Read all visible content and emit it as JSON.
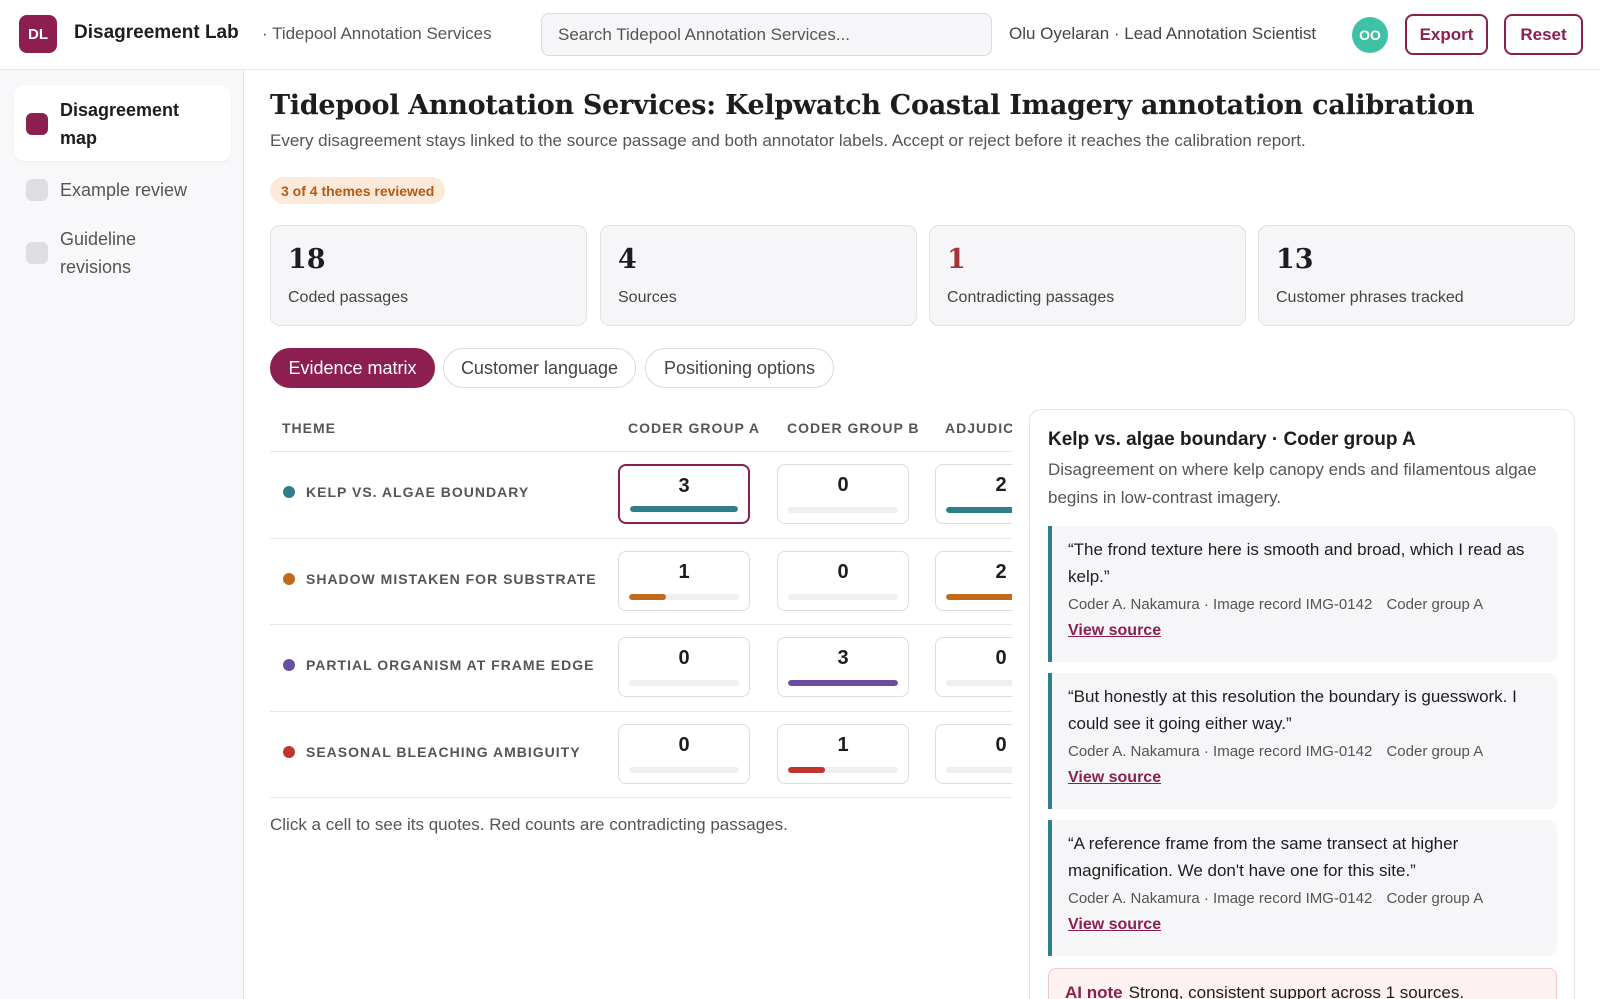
{
  "header": {
    "logo_initials": "DL",
    "app_name": "Disagreement Lab",
    "org_name": "· Tidepool Annotation Services",
    "search_placeholder": "Search Tidepool Annotation Services...",
    "user": "Olu Oyelaran · Lead Annotation Scientist",
    "avatar_initials": "OO",
    "export_label": "Export",
    "reset_label": "Reset"
  },
  "sidebar": {
    "items": [
      {
        "label": "Disagreement map",
        "active": true
      },
      {
        "label": "Example review",
        "active": false
      },
      {
        "label": "Guideline revisions",
        "active": false
      }
    ]
  },
  "main": {
    "title": "Tidepool Annotation Services: Kelpwatch Coastal Imagery annotation calibration",
    "subtitle": "Every disagreement stays linked to the source passage and both annotator labels. Accept or reject before it reaches the calibration report.",
    "progress_badge": "3 of 4 themes reviewed",
    "stats": [
      {
        "value": "18",
        "label": "Coded passages",
        "highlight": false
      },
      {
        "value": "4",
        "label": "Sources",
        "highlight": false
      },
      {
        "value": "1",
        "label": "Contradicting passages",
        "highlight": true
      },
      {
        "value": "13",
        "label": "Customer phrases tracked",
        "highlight": false
      }
    ],
    "tabs": [
      {
        "label": "Evidence matrix",
        "active": true
      },
      {
        "label": "Customer language",
        "active": false
      },
      {
        "label": "Positioning options",
        "active": false
      }
    ]
  },
  "matrix": {
    "columns": [
      "THEME",
      "CODER GROUP A",
      "CODER GROUP B",
      "ADJUDICATED"
    ],
    "max_count": 3,
    "rows": [
      {
        "theme": "KELP VS. ALGAE BOUNDARY",
        "color": "#2f7f8a",
        "counts": [
          3,
          0,
          2
        ]
      },
      {
        "theme": "SHADOW MISTAKEN FOR SUBSTRATE",
        "color": "#c26a1b",
        "counts": [
          1,
          0,
          2
        ]
      },
      {
        "theme": "PARTIAL ORGANISM AT FRAME EDGE",
        "color": "#6b4ea2",
        "counts": [
          0,
          3,
          0
        ]
      },
      {
        "theme": "SEASONAL BLEACHING AMBIGUITY",
        "color": "#c0362c",
        "counts": [
          0,
          1,
          0
        ]
      }
    ],
    "selected": {
      "row": 0,
      "col": 0
    },
    "note": "Click a cell to see its quotes. Red counts are contradicting passages."
  },
  "detail": {
    "title": "Kelp vs. algae boundary · Coder group A",
    "description": "Disagreement on where kelp canopy ends and filamentous algae begins in low-contrast imagery.",
    "quotes": [
      {
        "text": "“The frond texture here is smooth and broad, which I read as kelp.”",
        "author": "Coder A. Nakamura · Image record IMG-0142",
        "group": "Coder group A",
        "link": "View source"
      },
      {
        "text": "“But honestly at this resolution the boundary is guesswork. I could see it going either way.”",
        "author": "Coder A. Nakamura · Image record IMG-0142",
        "group": "Coder group A",
        "link": "View source"
      },
      {
        "text": "“A reference frame from the same transect at higher magnification. We don't have one for this site.”",
        "author": "Coder A. Nakamura · Image record IMG-0142",
        "group": "Coder group A",
        "link": "View source"
      }
    ],
    "ai_note_label": "AI note",
    "ai_note_text": "Strong, consistent support across 1 sources."
  }
}
